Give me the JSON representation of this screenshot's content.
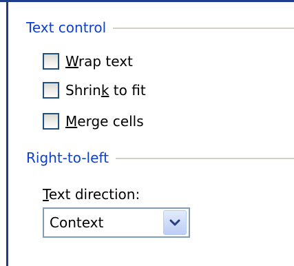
{
  "text_control": {
    "title": "Text control",
    "wrap_pre": "",
    "wrap_ul": "W",
    "wrap_post": "rap text",
    "shrink_pre": "Shrin",
    "shrink_ul": "k",
    "shrink_post": " to fit",
    "merge_pre": "",
    "merge_ul": "M",
    "merge_post": "erge cells"
  },
  "right_to_left": {
    "title": "Right-to-left",
    "dir_ul": "T",
    "dir_post": "ext direction:",
    "selected": "Context"
  },
  "icons": {
    "dropdown": "chevron-down-icon"
  },
  "colors": {
    "group_title": "#0a3fd1",
    "frame_edge": "#1f3d8a"
  }
}
